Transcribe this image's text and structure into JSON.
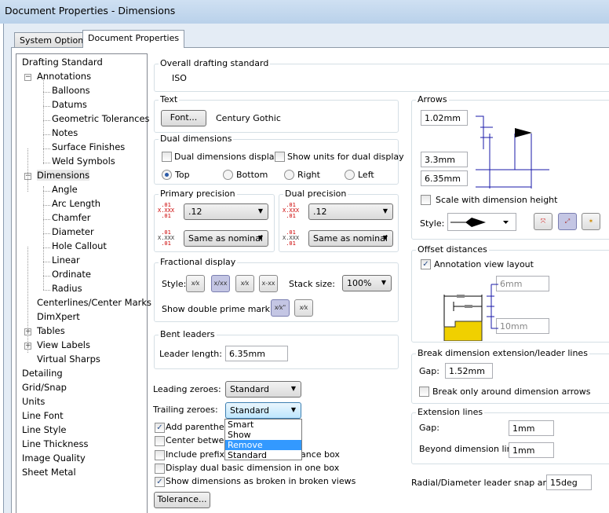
{
  "window": {
    "title": "Document Properties - Dimensions"
  },
  "tabs": [
    {
      "label": "System Options"
    },
    {
      "label": "Document Properties"
    }
  ],
  "tree": [
    {
      "label": "Drafting Standard",
      "level": 0
    },
    {
      "label": "Annotations",
      "level": 1,
      "expander": "−"
    },
    {
      "label": "Balloons",
      "level": 2
    },
    {
      "label": "Datums",
      "level": 2
    },
    {
      "label": "Geometric Tolerances",
      "level": 2
    },
    {
      "label": "Notes",
      "level": 2
    },
    {
      "label": "Surface Finishes",
      "level": 2
    },
    {
      "label": "Weld Symbols",
      "level": 2
    },
    {
      "label": "Dimensions",
      "level": 1,
      "expander": "−",
      "selected": true
    },
    {
      "label": "Angle",
      "level": 2
    },
    {
      "label": "Arc Length",
      "level": 2
    },
    {
      "label": "Chamfer",
      "level": 2
    },
    {
      "label": "Diameter",
      "level": 2
    },
    {
      "label": "Hole Callout",
      "level": 2
    },
    {
      "label": "Linear",
      "level": 2
    },
    {
      "label": "Ordinate",
      "level": 2
    },
    {
      "label": "Radius",
      "level": 2
    },
    {
      "label": "Centerlines/Center Marks",
      "level": 1
    },
    {
      "label": "DimXpert",
      "level": 1
    },
    {
      "label": "Tables",
      "level": 1,
      "expander": "+"
    },
    {
      "label": "View Labels",
      "level": 1,
      "expander": "+"
    },
    {
      "label": "Virtual Sharps",
      "level": 1
    },
    {
      "label": "Detailing",
      "level": 0
    },
    {
      "label": "Grid/Snap",
      "level": 0
    },
    {
      "label": "Units",
      "level": 0
    },
    {
      "label": "Line Font",
      "level": 0
    },
    {
      "label": "Line Style",
      "level": 0
    },
    {
      "label": "Line Thickness",
      "level": 0
    },
    {
      "label": "Image Quality",
      "level": 0
    },
    {
      "label": "Sheet Metal",
      "level": 0
    }
  ],
  "overall": {
    "label": "Overall drafting standard",
    "value": "ISO"
  },
  "text": {
    "label": "Text",
    "font_button": "Font...",
    "font_name": "Century Gothic"
  },
  "dual": {
    "label": "Dual dimensions",
    "display": "Dual dimensions display",
    "show_units": "Show units for dual display",
    "top": "Top",
    "bottom": "Bottom",
    "right": "Right",
    "left": "Left"
  },
  "primary": {
    "label": "Primary precision",
    "value": ".12",
    "tol": "Same as nominal"
  },
  "dualprec": {
    "label": "Dual precision",
    "value": ".12",
    "tol": "Same as nominal"
  },
  "precision_icon": {
    "top": ".01",
    "mid": "X.XXX",
    "bot": ".01"
  },
  "fractional": {
    "label": "Fractional display",
    "style": "Style:",
    "stack": "Stack size:",
    "stack_value": "100%",
    "prime": "Show double prime mark (\"):",
    "btn1": "x⁄x",
    "btn2": "x/xx",
    "btn3": "x⁄x",
    "btn4": "x-xx",
    "prime1": "x⁄x\"",
    "prime2": "x⁄x"
  },
  "bent": {
    "label": "Bent leaders",
    "length_label": "Leader length:",
    "length": "6.35mm"
  },
  "leading": {
    "label": "Leading zeroes:",
    "value": "Standard"
  },
  "trailing": {
    "label": "Trailing zeroes:",
    "value": "Standard",
    "options": [
      "Smart",
      "Show",
      "Remove",
      "Standard"
    ],
    "highlighted": "Remove"
  },
  "checks": [
    {
      "label": "Add parentheses by default",
      "checked": true
    },
    {
      "label": "Center between extension lines",
      "checked": false
    },
    {
      "label": "Include prefix inside basic tolerance box",
      "checked": false
    },
    {
      "label": "Display dual basic dimension in one box",
      "checked": false
    },
    {
      "label": "Show dimensions as broken in broken views",
      "checked": true
    }
  ],
  "check_visible": [
    "Add parenthese",
    "Center between",
    "Include prefix in",
    "box"
  ],
  "tolerance_button": "Tolerance...",
  "arrows": {
    "label": "Arrows",
    "h": "1.02mm",
    "w": "3.3mm",
    "l": "6.35mm",
    "scale": "Scale with dimension height",
    "style": "Style:"
  },
  "offset": {
    "label": "Offset distances",
    "layout": "Annotation view layout",
    "a": "6mm",
    "b": "10mm"
  },
  "break": {
    "label": "Break dimension extension/leader lines",
    "gap_label": "Gap:",
    "gap": "1.52mm",
    "only": "Break only around dimension arrows"
  },
  "ext": {
    "label": "Extension lines",
    "gap_label": "Gap:",
    "gap": "1mm",
    "beyond_label": "Beyond dimension line:",
    "beyond": "1mm"
  },
  "radial": {
    "label": "Radial/Diameter leader snap angle:",
    "value": "15deg"
  },
  "colors": {
    "accent": "#3399ff",
    "dim_blue": "#1a1aa8",
    "selected_button": "#c4c6e4"
  }
}
